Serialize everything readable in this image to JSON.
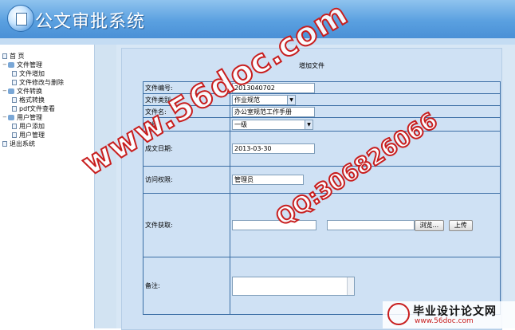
{
  "app": {
    "title": "公文审批系统"
  },
  "sidebar": {
    "items": [
      {
        "label": "首 页",
        "level": 0,
        "type": "page"
      },
      {
        "label": "文件管理",
        "level": 0,
        "type": "folder"
      },
      {
        "label": "文件增加",
        "level": 1,
        "type": "page"
      },
      {
        "label": "文件修改与删除",
        "level": 1,
        "type": "page"
      },
      {
        "label": "文件转换",
        "level": 0,
        "type": "folder"
      },
      {
        "label": "格式转换",
        "level": 1,
        "type": "page"
      },
      {
        "label": "pdf文件查看",
        "level": 1,
        "type": "page"
      },
      {
        "label": "用户管理",
        "level": 0,
        "type": "folder"
      },
      {
        "label": "用户添加",
        "level": 1,
        "type": "page"
      },
      {
        "label": "用户管理",
        "level": 1,
        "type": "page"
      },
      {
        "label": "退出系统",
        "level": 0,
        "type": "page"
      }
    ]
  },
  "form": {
    "title": "增加文件",
    "file_no_label": "文件编号:",
    "file_no_value": "2013040702",
    "file_type_label": "文件类别:",
    "file_type_value": "作业规范",
    "file_name_label": "文件名:",
    "file_name_value": "办公室规范工作手册",
    "secret_label": "密级:",
    "secret_value": "一级",
    "date_label": "成文日期:",
    "date_value": "2013-03-30",
    "access_label": "访问权限:",
    "access_value": "管理员",
    "fetch_label": "文件获取:",
    "browse_label": "浏览...",
    "upload_label": "上传",
    "remark_label": "备注:"
  },
  "watermark": {
    "site": "www.56doc.com",
    "qq": "QQ:306826066",
    "corner_title": "毕业设计论文网",
    "corner_url": "www.56doc.com"
  },
  "colors": {
    "header": "#5aa0e0",
    "panel": "#cfe1f4",
    "border": "#3b6ea5",
    "watermark": "#c81e1e"
  }
}
